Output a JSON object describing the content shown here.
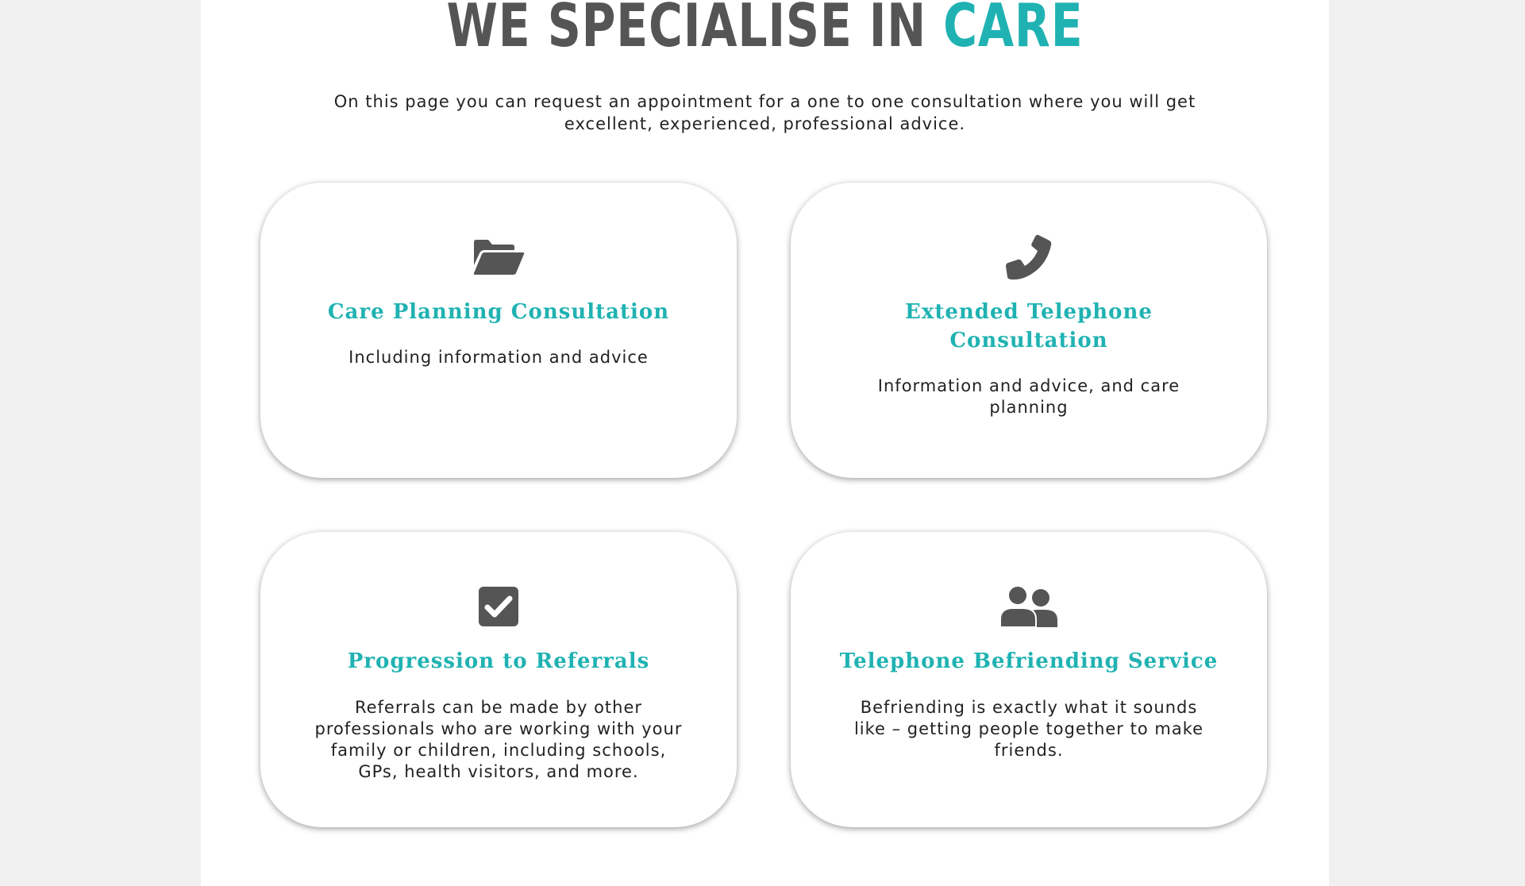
{
  "headline": {
    "prefix": "WE SPECIALISE IN",
    "accent": "CARE"
  },
  "intro": "On this page you can request an appointment for a one to one consultation where you will get excellent, experienced, professional advice.",
  "colors": {
    "accent": "#20b2b2",
    "icon": "#555555",
    "page_background": "#f0f0f0"
  },
  "services": [
    {
      "icon": "folder-open-icon",
      "title": "Care Planning Consultation",
      "description": "Including information and advice"
    },
    {
      "icon": "phone-icon",
      "title": "Extended Telephone Consultation",
      "description": "Information and advice, and care planning"
    },
    {
      "icon": "check-square-icon",
      "title": "Progression to Referrals",
      "description": "Referrals can be made by other professionals who are working with your family or children, including schools, GPs, health visitors, and more."
    },
    {
      "icon": "users-icon",
      "title": "Telephone Befriending Service",
      "description": "Befriending is exactly what it sounds like – getting people together to make friends."
    }
  ]
}
